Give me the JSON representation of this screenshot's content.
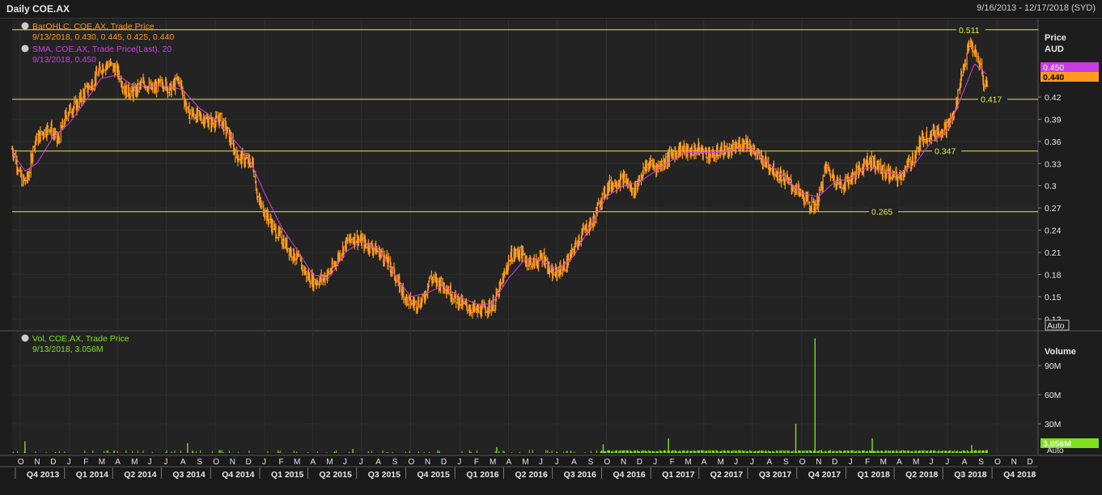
{
  "window": {
    "title": "Daily COE.AX",
    "date_range": "9/16/2013 - 12/17/2018 (SYD)"
  },
  "legend": {
    "price_series": "BarOHLC, COE.AX, Trade Price",
    "price_values": "9/13/2018, 0.430, 0.445, 0.425, 0.440",
    "sma_series": "SMA, COE.AX, Trade Price(Last),  20",
    "sma_values": "9/13/2018, 0.450",
    "vol_series": "Vol, COE.AX, Trade Price",
    "vol_values": "9/13/2018, 3.056M"
  },
  "price_axis": {
    "title": "Price",
    "unit": "AUD",
    "ticks": [
      "0.42",
      "0.39",
      "0.36",
      "0.33",
      "0.3",
      "0.27",
      "0.24",
      "0.21",
      "0.18",
      "0.15",
      "0.12"
    ],
    "sma_tag": "0.450",
    "last_tag": "0.440",
    "auto_label": "Auto"
  },
  "volume_axis": {
    "title": "Volume",
    "ticks": [
      "90M",
      "60M",
      "30M"
    ],
    "last_tag": "3.056M",
    "auto_label": "Auto"
  },
  "horizontal_lines": [
    {
      "value": 0.511,
      "label": "0.511"
    },
    {
      "value": 0.417,
      "label": "0.417"
    },
    {
      "value": 0.347,
      "label": "0.347"
    },
    {
      "value": 0.265,
      "label": "0.265"
    }
  ],
  "time_axis": {
    "months": [
      "O",
      "N",
      "D",
      "J",
      "F",
      "M",
      "A",
      "M",
      "J",
      "J",
      "A",
      "S",
      "O",
      "N",
      "D",
      "J",
      "F",
      "M",
      "A",
      "M",
      "J",
      "J",
      "A",
      "S",
      "O",
      "N",
      "D",
      "J",
      "F",
      "M",
      "A",
      "M",
      "J",
      "J",
      "A",
      "S",
      "O",
      "N",
      "D",
      "J",
      "F",
      "M",
      "A",
      "M",
      "J",
      "J",
      "A",
      "S",
      "O",
      "N",
      "D",
      "J",
      "F",
      "M",
      "A",
      "M",
      "J",
      "J",
      "A",
      "S",
      "O",
      "N",
      "D"
    ],
    "quarters": [
      "Q4 2013",
      "Q1 2014",
      "Q2 2014",
      "Q3 2014",
      "Q4 2014",
      "Q1 2015",
      "Q2 2015",
      "Q3 2015",
      "Q4 2015",
      "Q1 2016",
      "Q2 2016",
      "Q3 2016",
      "Q4 2016",
      "Q1 2017",
      "Q2 2017",
      "Q3 2017",
      "Q4 2017",
      "Q1 2018",
      "Q2 2018",
      "Q3 2018",
      "Q4 2018"
    ]
  },
  "colors": {
    "price": "#ff9a1f",
    "sma": "#d040e0",
    "volume": "#7fe01f",
    "hline": "#e8e84a",
    "grid": "#2e2e2e"
  },
  "chart_data": [
    {
      "type": "line",
      "title": "Daily COE.AX",
      "series": [
        {
          "name": "BarOHLC, COE.AX, Trade Price",
          "points": [
            [
              "2013-09-16",
              0.35
            ],
            [
              "2013-09-25",
              0.33
            ],
            [
              "2013-10-05",
              0.305
            ],
            [
              "2013-10-15",
              0.31
            ],
            [
              "2013-10-28",
              0.36
            ],
            [
              "2013-11-10",
              0.37
            ],
            [
              "2013-11-25",
              0.38
            ],
            [
              "2013-12-10",
              0.36
            ],
            [
              "2013-12-28",
              0.4
            ],
            [
              "2014-01-15",
              0.41
            ],
            [
              "2014-02-01",
              0.43
            ],
            [
              "2014-02-15",
              0.44
            ],
            [
              "2014-03-01",
              0.46
            ],
            [
              "2014-03-15",
              0.465
            ],
            [
              "2014-04-01",
              0.455
            ],
            [
              "2014-04-15",
              0.43
            ],
            [
              "2014-05-01",
              0.425
            ],
            [
              "2014-05-20",
              0.44
            ],
            [
              "2014-06-05",
              0.43
            ],
            [
              "2014-06-25",
              0.44
            ],
            [
              "2014-07-10",
              0.43
            ],
            [
              "2014-07-25",
              0.445
            ],
            [
              "2014-08-10",
              0.4
            ],
            [
              "2014-08-25",
              0.395
            ],
            [
              "2014-09-10",
              0.39
            ],
            [
              "2014-09-25",
              0.385
            ],
            [
              "2014-10-10",
              0.39
            ],
            [
              "2014-10-25",
              0.37
            ],
            [
              "2014-11-10",
              0.34
            ],
            [
              "2014-11-25",
              0.335
            ],
            [
              "2014-12-10",
              0.33
            ],
            [
              "2014-12-20",
              0.28
            ],
            [
              "2015-01-05",
              0.26
            ],
            [
              "2015-01-20",
              0.24
            ],
            [
              "2015-02-05",
              0.225
            ],
            [
              "2015-02-20",
              0.21
            ],
            [
              "2015-03-05",
              0.2
            ],
            [
              "2015-03-20",
              0.18
            ],
            [
              "2015-04-05",
              0.17
            ],
            [
              "2015-04-20",
              0.175
            ],
            [
              "2015-05-05",
              0.185
            ],
            [
              "2015-05-20",
              0.205
            ],
            [
              "2015-06-05",
              0.225
            ],
            [
              "2015-06-20",
              0.23
            ],
            [
              "2015-07-10",
              0.22
            ],
            [
              "2015-07-25",
              0.215
            ],
            [
              "2015-08-10",
              0.205
            ],
            [
              "2015-08-25",
              0.19
            ],
            [
              "2015-09-10",
              0.165
            ],
            [
              "2015-09-25",
              0.145
            ],
            [
              "2015-10-10",
              0.14
            ],
            [
              "2015-10-25",
              0.145
            ],
            [
              "2015-11-05",
              0.175
            ],
            [
              "2015-11-20",
              0.17
            ],
            [
              "2015-12-05",
              0.165
            ],
            [
              "2015-12-20",
              0.15
            ],
            [
              "2016-01-05",
              0.14
            ],
            [
              "2016-01-20",
              0.135
            ],
            [
              "2016-02-05",
              0.13
            ],
            [
              "2016-02-20",
              0.135
            ],
            [
              "2016-03-05",
              0.14
            ],
            [
              "2016-03-20",
              0.17
            ],
            [
              "2016-04-05",
              0.205
            ],
            [
              "2016-04-20",
              0.21
            ],
            [
              "2016-05-05",
              0.2
            ],
            [
              "2016-05-20",
              0.195
            ],
            [
              "2016-06-05",
              0.205
            ],
            [
              "2016-06-20",
              0.18
            ],
            [
              "2016-07-05",
              0.185
            ],
            [
              "2016-07-20",
              0.195
            ],
            [
              "2016-08-05",
              0.22
            ],
            [
              "2016-08-20",
              0.24
            ],
            [
              "2016-09-05",
              0.25
            ],
            [
              "2016-09-20",
              0.28
            ],
            [
              "2016-10-05",
              0.3
            ],
            [
              "2016-10-20",
              0.305
            ],
            [
              "2016-11-05",
              0.31
            ],
            [
              "2016-11-20",
              0.29
            ],
            [
              "2016-12-05",
              0.315
            ],
            [
              "2016-12-20",
              0.33
            ],
            [
              "2017-01-05",
              0.325
            ],
            [
              "2017-01-20",
              0.335
            ],
            [
              "2017-02-05",
              0.345
            ],
            [
              "2017-02-20",
              0.35
            ],
            [
              "2017-03-05",
              0.345
            ],
            [
              "2017-03-20",
              0.35
            ],
            [
              "2017-04-05",
              0.345
            ],
            [
              "2017-04-20",
              0.34
            ],
            [
              "2017-05-05",
              0.35
            ],
            [
              "2017-05-20",
              0.345
            ],
            [
              "2017-06-05",
              0.355
            ],
            [
              "2017-06-20",
              0.36
            ],
            [
              "2017-07-05",
              0.345
            ],
            [
              "2017-07-20",
              0.335
            ],
            [
              "2017-08-05",
              0.325
            ],
            [
              "2017-08-20",
              0.315
            ],
            [
              "2017-09-05",
              0.305
            ],
            [
              "2017-09-20",
              0.295
            ],
            [
              "2017-10-05",
              0.285
            ],
            [
              "2017-10-20",
              0.27
            ],
            [
              "2017-11-01",
              0.28
            ],
            [
              "2017-11-15",
              0.325
            ],
            [
              "2017-12-01",
              0.31
            ],
            [
              "2017-12-15",
              0.3
            ],
            [
              "2018-01-01",
              0.31
            ],
            [
              "2018-01-15",
              0.32
            ],
            [
              "2018-02-01",
              0.335
            ],
            [
              "2018-02-15",
              0.33
            ],
            [
              "2018-03-01",
              0.32
            ],
            [
              "2018-03-15",
              0.315
            ],
            [
              "2018-04-01",
              0.31
            ],
            [
              "2018-04-15",
              0.325
            ],
            [
              "2018-05-01",
              0.34
            ],
            [
              "2018-05-15",
              0.365
            ],
            [
              "2018-06-01",
              0.37
            ],
            [
              "2018-06-15",
              0.375
            ],
            [
              "2018-07-01",
              0.38
            ],
            [
              "2018-07-15",
              0.4
            ],
            [
              "2018-07-25",
              0.445
            ],
            [
              "2018-08-05",
              0.475
            ],
            [
              "2018-08-12",
              0.495
            ],
            [
              "2018-08-20",
              0.48
            ],
            [
              "2018-09-01",
              0.46
            ],
            [
              "2018-09-07",
              0.435
            ],
            [
              "2018-09-13",
              0.44
            ]
          ]
        },
        {
          "name": "SMA, COE.AX, Trade Price(Last),  20",
          "points": [
            [
              "2013-09-16",
              0.345
            ],
            [
              "2013-10-10",
              0.32
            ],
            [
              "2013-11-01",
              0.33
            ],
            [
              "2013-12-01",
              0.365
            ],
            [
              "2014-01-01",
              0.385
            ],
            [
              "2014-02-01",
              0.415
            ],
            [
              "2014-03-01",
              0.445
            ],
            [
              "2014-04-01",
              0.45
            ],
            [
              "2014-05-01",
              0.435
            ],
            [
              "2014-06-01",
              0.435
            ],
            [
              "2014-07-01",
              0.435
            ],
            [
              "2014-08-01",
              0.43
            ],
            [
              "2014-09-01",
              0.405
            ],
            [
              "2014-10-01",
              0.39
            ],
            [
              "2014-11-01",
              0.365
            ],
            [
              "2014-12-01",
              0.34
            ],
            [
              "2015-01-01",
              0.29
            ],
            [
              "2015-02-01",
              0.245
            ],
            [
              "2015-03-01",
              0.215
            ],
            [
              "2015-04-01",
              0.18
            ],
            [
              "2015-05-01",
              0.175
            ],
            [
              "2015-06-01",
              0.21
            ],
            [
              "2015-07-01",
              0.225
            ],
            [
              "2015-08-01",
              0.215
            ],
            [
              "2015-09-01",
              0.18
            ],
            [
              "2015-10-01",
              0.15
            ],
            [
              "2015-11-01",
              0.155
            ],
            [
              "2015-12-01",
              0.165
            ],
            [
              "2016-01-01",
              0.15
            ],
            [
              "2016-02-01",
              0.14
            ],
            [
              "2016-03-01",
              0.14
            ],
            [
              "2016-04-01",
              0.175
            ],
            [
              "2016-05-01",
              0.2
            ],
            [
              "2016-06-01",
              0.2
            ],
            [
              "2016-07-01",
              0.185
            ],
            [
              "2016-08-01",
              0.205
            ],
            [
              "2016-09-01",
              0.245
            ],
            [
              "2016-10-01",
              0.285
            ],
            [
              "2016-11-01",
              0.3
            ],
            [
              "2016-12-01",
              0.305
            ],
            [
              "2017-01-01",
              0.32
            ],
            [
              "2017-02-01",
              0.335
            ],
            [
              "2017-03-01",
              0.345
            ],
            [
              "2017-04-01",
              0.345
            ],
            [
              "2017-05-01",
              0.345
            ],
            [
              "2017-06-01",
              0.35
            ],
            [
              "2017-07-01",
              0.35
            ],
            [
              "2017-08-01",
              0.33
            ],
            [
              "2017-09-01",
              0.31
            ],
            [
              "2017-10-01",
              0.29
            ],
            [
              "2017-11-01",
              0.285
            ],
            [
              "2017-12-01",
              0.305
            ],
            [
              "2018-01-01",
              0.31
            ],
            [
              "2018-02-01",
              0.325
            ],
            [
              "2018-03-01",
              0.32
            ],
            [
              "2018-04-01",
              0.315
            ],
            [
              "2018-05-01",
              0.33
            ],
            [
              "2018-06-01",
              0.36
            ],
            [
              "2018-07-01",
              0.375
            ],
            [
              "2018-08-01",
              0.43
            ],
            [
              "2018-08-20",
              0.465
            ],
            [
              "2018-09-13",
              0.45
            ]
          ]
        }
      ],
      "ylim": [
        0.105,
        0.525
      ],
      "reference_lines": [
        0.511,
        0.417,
        0.347,
        0.265
      ]
    },
    {
      "type": "bar",
      "series": [
        {
          "name": "Vol, COE.AX, Trade Price",
          "baseline_millions": 2,
          "spikes": [
            [
              "2013-10-10",
              12
            ],
            [
              "2014-08-10",
              10
            ],
            [
              "2015-06-15",
              4
            ],
            [
              "2016-03-10",
              6
            ],
            [
              "2016-09-25",
              9
            ],
            [
              "2017-01-25",
              15
            ],
            [
              "2017-09-20",
              30
            ],
            [
              "2017-10-26",
              118
            ],
            [
              "2018-02-10",
              15
            ],
            [
              "2018-08-15",
              8
            ],
            [
              "2018-09-13",
              3.056
            ]
          ]
        }
      ],
      "ylim": [
        0,
        125
      ]
    }
  ]
}
